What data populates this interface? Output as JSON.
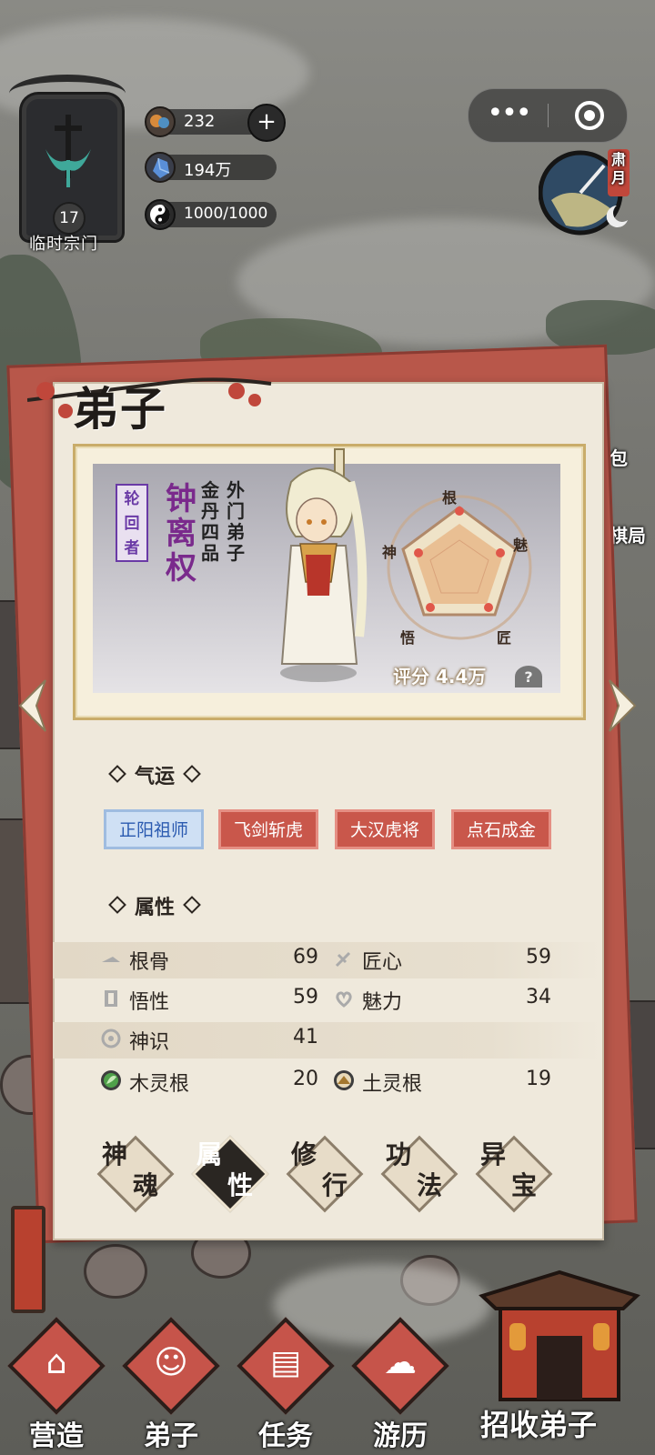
{
  "sect": {
    "level": "17",
    "name": "临时宗门"
  },
  "resources": [
    {
      "icon": "spirit-cloud-icon",
      "value": "232"
    },
    {
      "icon": "spirit-stone-icon",
      "value": "194万"
    },
    {
      "icon": "yin-yang-icon",
      "value": "1000/1000"
    }
  ],
  "capsule": {
    "more": "•••"
  },
  "dial": {
    "label": "肃月"
  },
  "side_menu": {
    "bag": "背包",
    "chess": "回棋局"
  },
  "panel": {
    "title": "弟子"
  },
  "disciple": {
    "tag": "轮回者",
    "name": "钟离权",
    "rank": "金丹四品",
    "role": "外门弟子",
    "radar_labels": {
      "top": "根",
      "right": "魅",
      "bottom_right": "匠",
      "bottom_left": "悟",
      "left": "神"
    },
    "score": "评分 4.4万",
    "help": "?"
  },
  "luck": {
    "header": "气运",
    "tags": [
      "正阳祖师",
      "飞剑斩虎",
      "大汉虎将",
      "点石成金"
    ]
  },
  "attributes": {
    "header": "属性",
    "items": [
      {
        "name": "根骨",
        "value": "69",
        "icon": "bone-icon"
      },
      {
        "name": "匠心",
        "value": "59",
        "icon": "craft-icon"
      },
      {
        "name": "悟性",
        "value": "59",
        "icon": "book-icon"
      },
      {
        "name": "魅力",
        "value": "34",
        "icon": "charm-icon"
      },
      {
        "name": "神识",
        "value": "41",
        "icon": "spirit-sense-icon"
      },
      {
        "name": "木灵根",
        "value": "20",
        "icon": "wood-root-icon"
      },
      {
        "name": "土灵根",
        "value": "19",
        "icon": "earth-root-icon"
      }
    ]
  },
  "tabs": [
    {
      "a": "神",
      "b": "魂"
    },
    {
      "a": "属",
      "b": "性"
    },
    {
      "a": "修",
      "b": "行"
    },
    {
      "a": "功",
      "b": "法"
    },
    {
      "a": "异",
      "b": "宝"
    }
  ],
  "nav": [
    "营造",
    "弟子",
    "任务",
    "游历"
  ],
  "recruit": "招收弟子",
  "colors": {
    "accent_red": "#c9574b",
    "active_blue": "#2a5ab0",
    "name_purple": "#7a2a8c"
  }
}
